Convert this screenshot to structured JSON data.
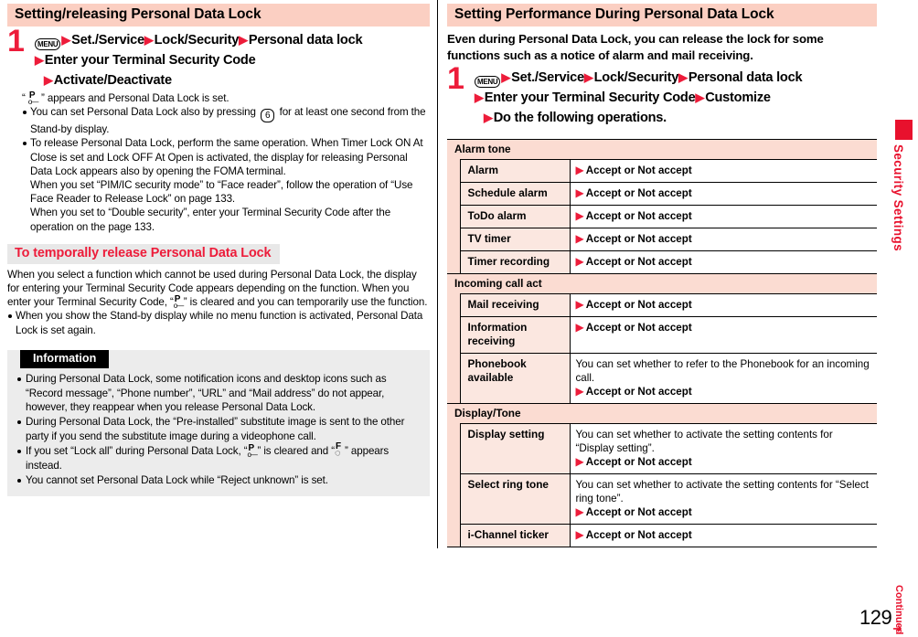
{
  "left": {
    "title": "Setting/releasing Personal Data Lock",
    "step": {
      "number": "1",
      "menu_key": "MENU",
      "line1_items": [
        "Set./Service",
        "Lock/Security",
        "Personal data lock"
      ],
      "line2": "Enter your Terminal Security Code",
      "line3": "Activate/Deactivate"
    },
    "notes": {
      "icon_note_prefix": "“",
      "icon_note_suffix": "” appears and Personal Data Lock is set.",
      "bullets": [
        "You can set Personal Data Lock also by pressing  6  for at least one second from the Stand-by display.",
        "To release Personal Data Lock, perform the same operation. When Timer Lock ON At Close is set and Lock OFF At Open is activated, the display for releasing Personal Data Lock appears also by opening the FOMA terminal."
      ],
      "bullet2_extra_line1": "When you set “PIM/IC security mode” to “Face reader”, follow the operation of “Use Face Reader to Release Lock” on page 133.",
      "bullet2_extra_line2": "When you set to “Double security”, enter your Terminal Security Code after the operation on the page 133."
    },
    "subhead": "To temporally release Personal Data Lock",
    "sub_para_a": "When you select a function which cannot be used during Personal Data Lock, the display for entering your Terminal Security Code appears depending on the function. When you enter your Terminal Security Code, “",
    "sub_para_b": "” is cleared and you can temporarily use the function.",
    "sub_bullet": "When you show the Stand-by display while no menu function is activated, Personal Data Lock is set again.",
    "information": {
      "title": "Information",
      "items": [
        "During Personal Data Lock, some notification icons and desktop icons such as “Record message”, “Phone number”, “URL” and “Mail address” do not appear, however, they reappear when you release Personal Data Lock.",
        "During Personal Data Lock, the “Pre-installed” substitute image is sent to the other party if you send the substitute image during a videophone call.",
        "You cannot set Personal Data Lock while “Reject unknown” is set."
      ],
      "item_lockall_a": "If you set “Lock all” during Personal Data Lock, “",
      "item_lockall_b": "” is cleared and “",
      "item_lockall_c": "” appears instead."
    }
  },
  "right": {
    "title": "Setting Performance During Personal Data Lock",
    "intro": "Even during Personal Data Lock, you can release the lock for some functions such as a notice of alarm and mail receiving.",
    "step": {
      "number": "1",
      "menu_key": "MENU",
      "line1_items": [
        "Set./Service",
        "Lock/Security",
        "Personal data lock"
      ],
      "line2_items": [
        "Enter your Terminal Security Code",
        "Customize"
      ],
      "line3": "Do the following operations."
    },
    "table": [
      {
        "group": "Alarm tone",
        "rows": [
          {
            "label": "Alarm",
            "desc": "",
            "action": "Accept or Not accept"
          },
          {
            "label": "Schedule alarm",
            "desc": "",
            "action": "Accept or Not accept"
          },
          {
            "label": "ToDo alarm",
            "desc": "",
            "action": "Accept or Not accept"
          },
          {
            "label": "TV timer",
            "desc": "",
            "action": "Accept or Not accept"
          },
          {
            "label": "Timer recording",
            "desc": "",
            "action": "Accept or Not accept"
          }
        ]
      },
      {
        "group": "Incoming call act",
        "rows": [
          {
            "label": "Mail receiving",
            "desc": "",
            "action": "Accept or Not accept"
          },
          {
            "label": "Information receiving",
            "desc": "",
            "action": "Accept or Not accept"
          },
          {
            "label": "Phonebook available",
            "desc": "You can set whether to refer to the Phonebook for an incoming call.",
            "action": "Accept or Not accept"
          }
        ]
      },
      {
        "group": "Display/Tone",
        "rows": [
          {
            "label": "Display setting",
            "desc": "You can set whether to activate the setting contents for “Display setting”.",
            "action": "Accept or Not accept"
          },
          {
            "label": "Select ring tone",
            "desc": "You can set whether to activate the setting contents for “Select ring tone”.",
            "action": "Accept or Not accept"
          },
          {
            "label": "i-Channel ticker",
            "desc": "",
            "action": "Accept or Not accept"
          }
        ]
      }
    ]
  },
  "sidebar": {
    "chapter": "Security Settings"
  },
  "footer": {
    "page_number": "129",
    "continued": "Continued",
    "arrow": "➜"
  },
  "colors": {
    "title_bar": "#fbcfc2",
    "accent_red": "#ed1c3a",
    "chapter_red": "#e8112d",
    "table_group": "#fbdcd2",
    "table_label": "#fbe7e0",
    "info_bg": "#ececec",
    "subhead_bg": "#e8e8e8"
  }
}
